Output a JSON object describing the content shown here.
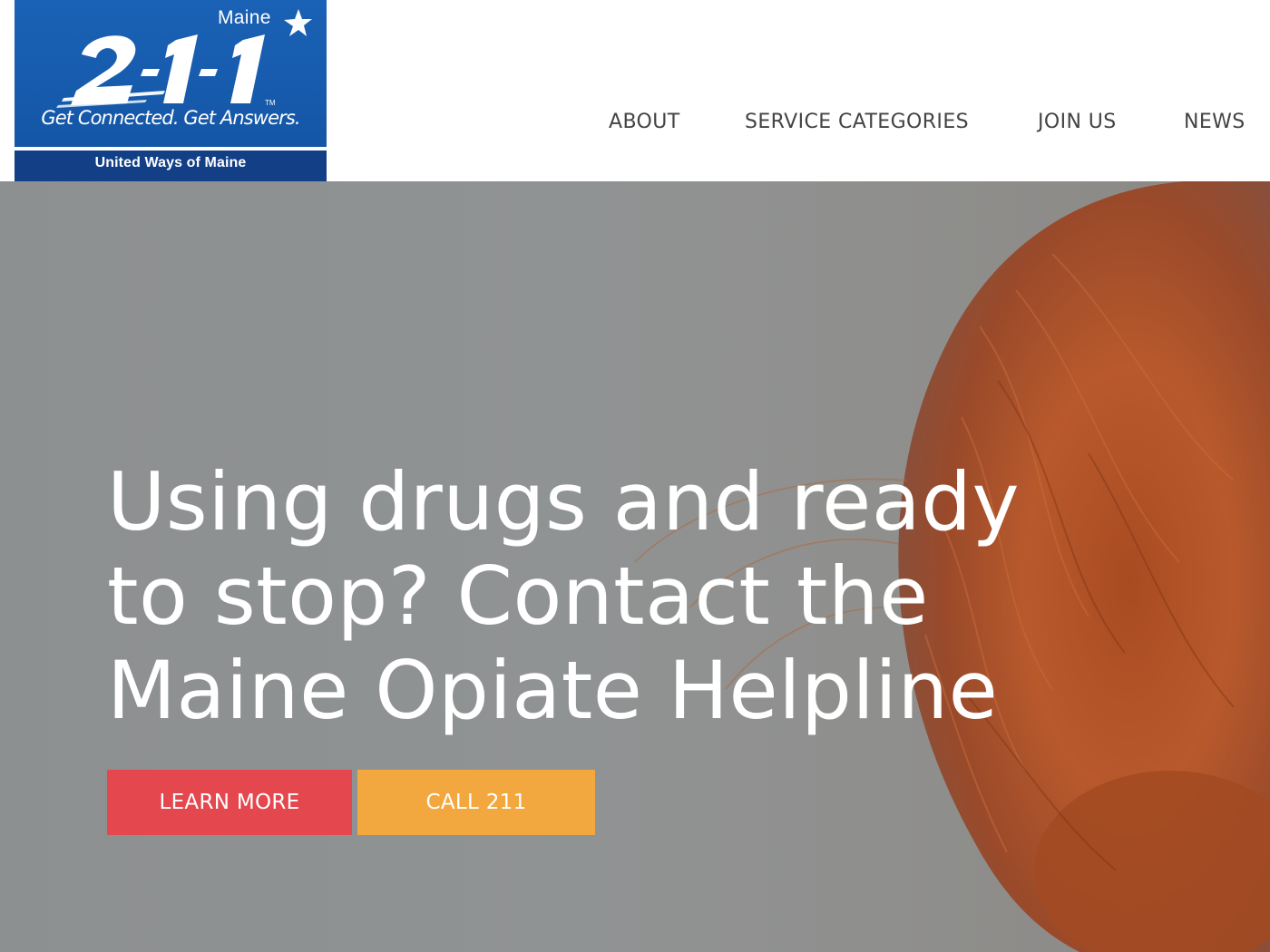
{
  "header": {
    "logo": {
      "state": "Maine",
      "number": "2-1-1",
      "trademark": "TM",
      "tagline": "Get Connected. Get Answers.",
      "organization": "United Ways of Maine",
      "icon": "star-icon",
      "brand_color": "#1558a8"
    },
    "nav": {
      "about": "ABOUT",
      "services": "SERVICE CATEGORIES",
      "join": "JOIN US",
      "news": "NEWS"
    }
  },
  "hero": {
    "title": "Using drugs and ready to stop? Contact the Maine Opiate Helpline",
    "learn_more": "LEARN MORE",
    "call": "CALL 211",
    "colors": {
      "learn_more": "#e4474e",
      "call": "#f2a83e"
    }
  }
}
